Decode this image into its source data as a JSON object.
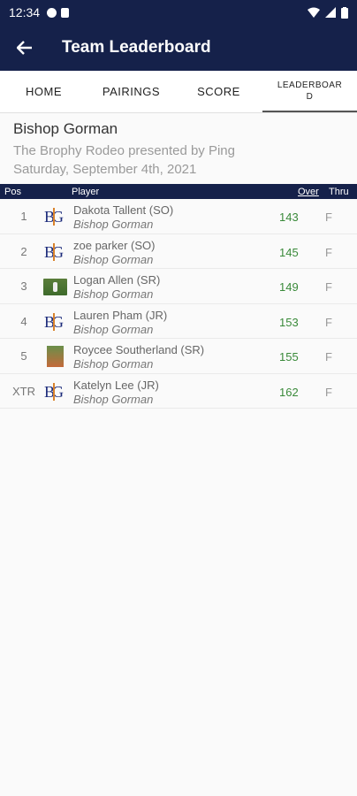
{
  "status": {
    "time": "12:34"
  },
  "appbar": {
    "title": "Team Leaderboard"
  },
  "tabs": [
    {
      "label": "HOME"
    },
    {
      "label": "PAIRINGS"
    },
    {
      "label": "SCORE"
    },
    {
      "label": "LEADERBOAR\nD"
    }
  ],
  "info": {
    "school": "Bishop Gorman",
    "event": "The Brophy Rodeo presented by Ping",
    "date": "Saturday, September 4th, 2021"
  },
  "table_header": {
    "pos": "Pos",
    "player": "Player",
    "over": "Over",
    "thru": "Thru"
  },
  "rows": [
    {
      "pos": "1",
      "name": "Dakota Tallent (SO)",
      "team": "Bishop Gorman",
      "over": "143",
      "thru": "F",
      "avatar": "logo"
    },
    {
      "pos": "2",
      "name": "zoe parker (SO)",
      "team": "Bishop Gorman",
      "over": "145",
      "thru": "F",
      "avatar": "logo"
    },
    {
      "pos": "3",
      "name": "Logan Allen (SR)",
      "team": "Bishop Gorman",
      "over": "149",
      "thru": "F",
      "avatar": "photo"
    },
    {
      "pos": "4",
      "name": "Lauren Pham (JR)",
      "team": "Bishop Gorman",
      "over": "153",
      "thru": "F",
      "avatar": "logo"
    },
    {
      "pos": "5",
      "name": "Roycee Southerland (SR)",
      "team": "Bishop Gorman",
      "over": "155",
      "thru": "F",
      "avatar": "photo2"
    },
    {
      "pos": "XTR",
      "name": "Katelyn Lee (JR)",
      "team": "Bishop Gorman",
      "over": "162",
      "thru": "F",
      "avatar": "logo"
    }
  ],
  "logo_text": "BG"
}
